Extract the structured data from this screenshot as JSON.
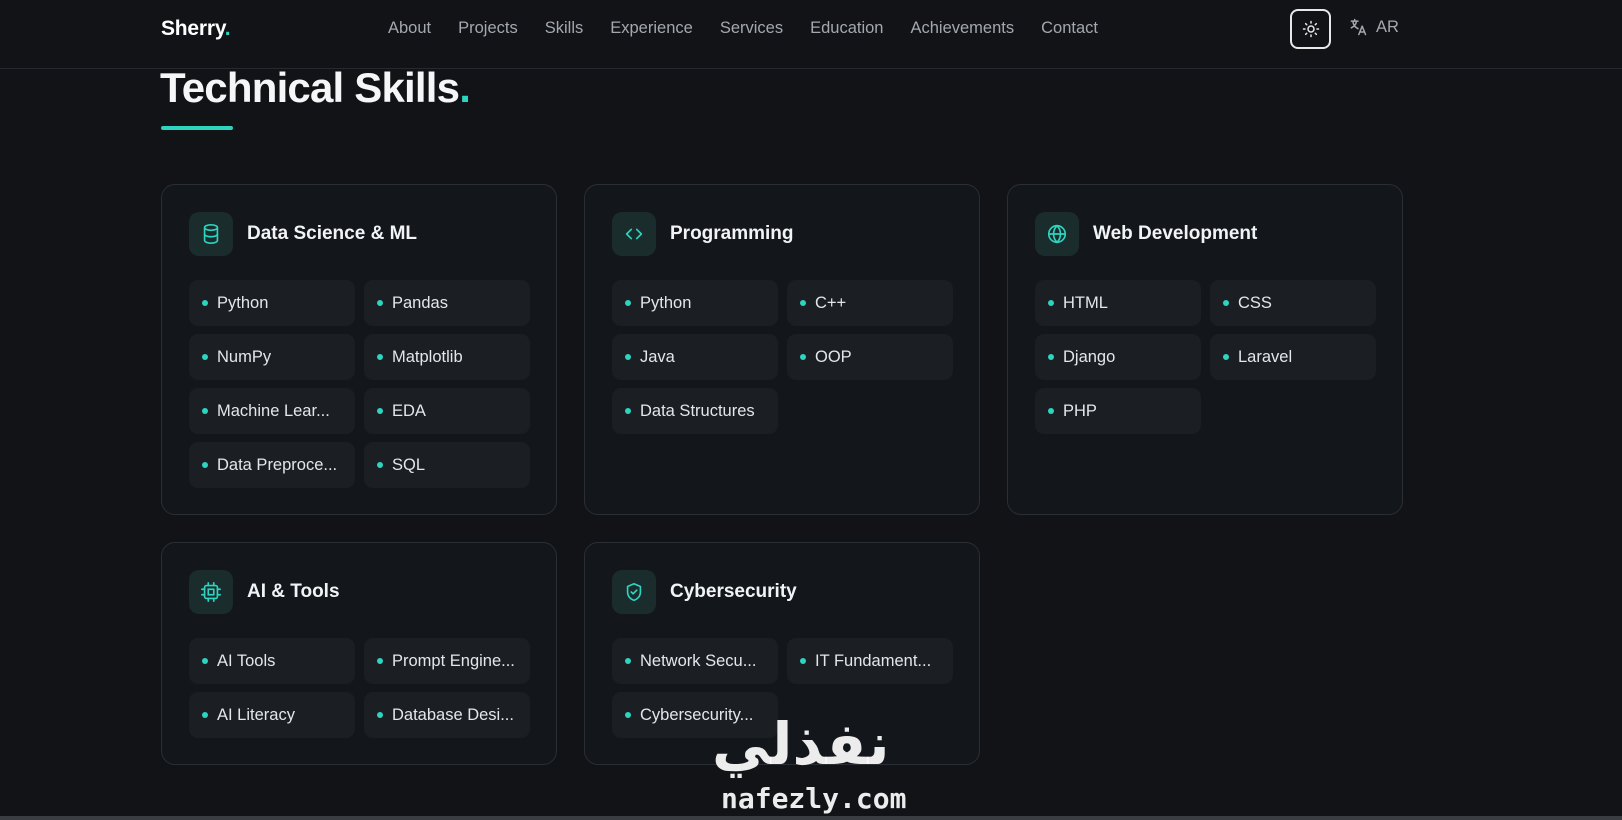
{
  "brand": {
    "name": "Sherry",
    "dot": "."
  },
  "nav": {
    "links": [
      "About",
      "Projects",
      "Skills",
      "Experience",
      "Services",
      "Education",
      "Achievements",
      "Contact"
    ],
    "lang_label": "AR"
  },
  "section": {
    "title": "Technical Skills",
    "dot": "."
  },
  "cards": [
    {
      "title": "Data Science & ML",
      "icon": "database-icon",
      "skills": [
        "Python",
        "Pandas",
        "NumPy",
        "Matplotlib",
        "Machine Lear...",
        "EDA",
        "Data Preproce...",
        "SQL"
      ]
    },
    {
      "title": "Programming",
      "icon": "code-icon",
      "skills": [
        "Python",
        "C++",
        "Java",
        "OOP",
        "Data Structures"
      ]
    },
    {
      "title": "Web Development",
      "icon": "globe-icon",
      "skills": [
        "HTML",
        "CSS",
        "Django",
        "Laravel",
        "PHP"
      ]
    },
    {
      "title": "AI & Tools",
      "icon": "cpu-icon",
      "skills": [
        "AI Tools",
        "Prompt Engine...",
        "AI Literacy",
        "Database Desi..."
      ]
    },
    {
      "title": "Cybersecurity",
      "icon": "shield-icon",
      "skills": [
        "Network Secu...",
        "IT Fundament...",
        "Cybersecurity..."
      ]
    }
  ],
  "watermark": {
    "arabic": "نفذلي",
    "latin": "nafezly.com"
  },
  "colors": {
    "accent": "#2dd4bf",
    "background": "#111317",
    "card": "#13161a",
    "chip": "#1b1e23"
  }
}
